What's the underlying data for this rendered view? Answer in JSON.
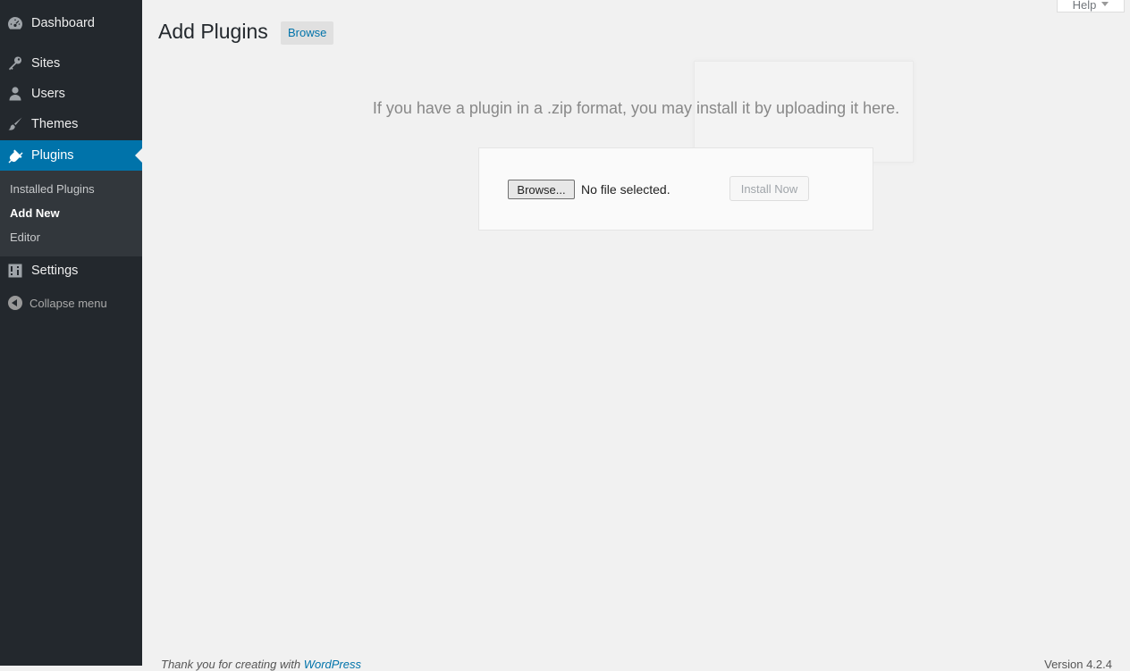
{
  "sidebar": {
    "items": [
      {
        "label": "Dashboard",
        "icon": "dashboard-icon"
      },
      {
        "label": "Sites",
        "icon": "key-icon"
      },
      {
        "label": "Users",
        "icon": "user-icon"
      },
      {
        "label": "Themes",
        "icon": "brush-icon"
      },
      {
        "label": "Plugins",
        "icon": "plugin-icon",
        "active": true
      },
      {
        "label": "Settings",
        "icon": "settings-icon"
      }
    ],
    "submenu": [
      {
        "label": "Installed Plugins"
      },
      {
        "label": "Add New",
        "current": true
      },
      {
        "label": "Editor"
      }
    ],
    "collapse_label": "Collapse menu"
  },
  "header": {
    "title": "Add Plugins",
    "action_label": "Browse",
    "help_label": "Help"
  },
  "upload": {
    "message": "If you have a plugin in a .zip format, you may install it by uploading it here.",
    "browse_label": "Browse...",
    "file_status": "No file selected.",
    "install_label": "Install Now"
  },
  "footer": {
    "thanks_text": "Thank you for creating with ",
    "wordpress_link": "WordPress",
    "version": "Version 4.2.4"
  },
  "colors": {
    "sidebar_bg": "#23282d",
    "submenu_bg": "#32373c",
    "accent": "#0073aa",
    "page_bg": "#f1f1f1"
  }
}
